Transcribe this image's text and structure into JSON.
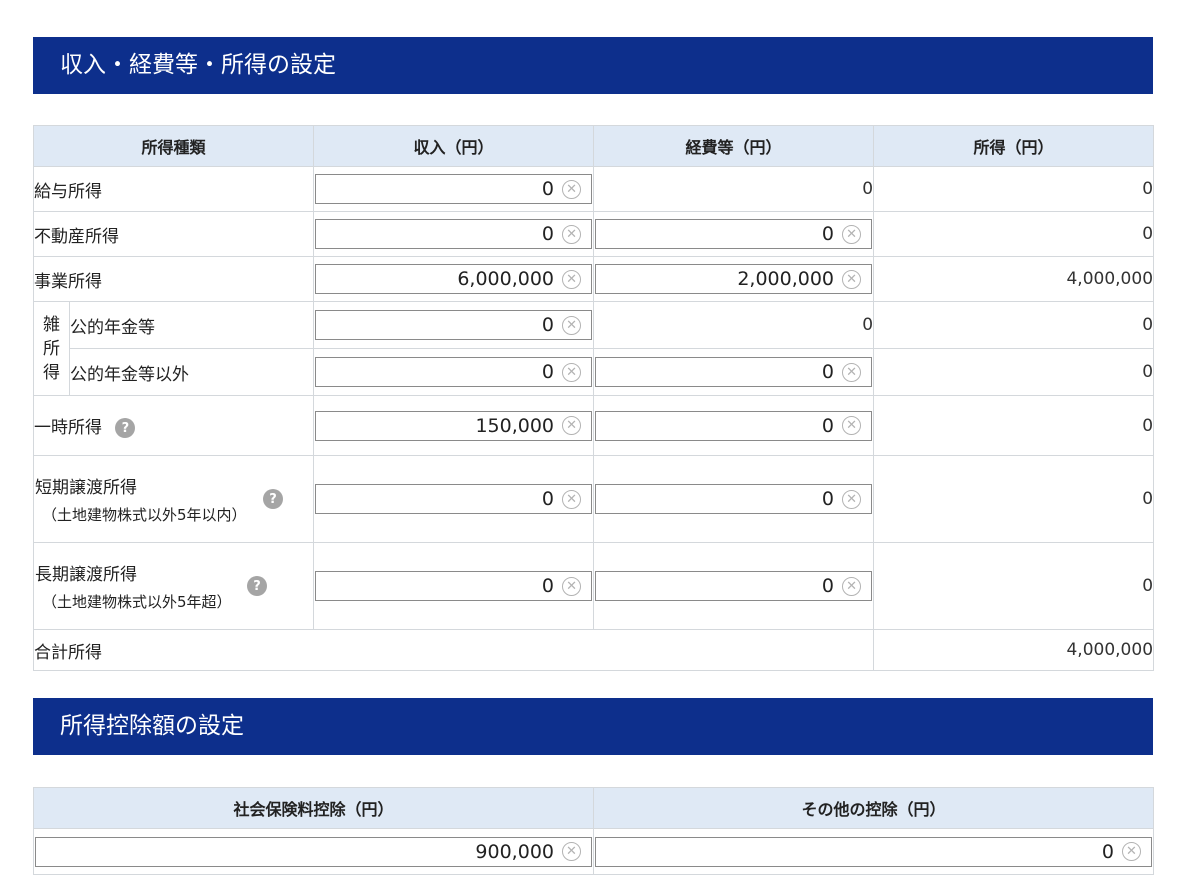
{
  "income_section": {
    "title": "収入・経費等・所得の設定",
    "headers": [
      "所得種類",
      "収入（円）",
      "経費等（円）",
      "所得（円）"
    ],
    "rows": {
      "kyuyo": {
        "label": "給与所得",
        "income": "0",
        "expense": "0",
        "result": "0"
      },
      "fudosan": {
        "label": "不動産所得",
        "income": "0",
        "expense": "0",
        "result": "0"
      },
      "jigyo": {
        "label": "事業所得",
        "income": "6,000,000",
        "expense": "2,000,000",
        "result": "4,000,000"
      },
      "zatsu_group": "雑所得",
      "nenkin": {
        "label": "公的年金等",
        "income": "0",
        "expense": "0",
        "result": "0"
      },
      "nenkin_igai": {
        "label": "公的年金等以外",
        "income": "0",
        "expense": "0",
        "result": "0"
      },
      "ichiji": {
        "label": "一時所得",
        "income": "150,000",
        "expense": "0",
        "result": "0"
      },
      "tanki": {
        "label": "短期譲渡所得",
        "sub": "（土地建物株式以外5年以内）",
        "income": "0",
        "expense": "0",
        "result": "0"
      },
      "choki": {
        "label": "長期譲渡所得",
        "sub": "（土地建物株式以外5年超）",
        "income": "0",
        "expense": "0",
        "result": "0"
      },
      "total": {
        "label": "合計所得",
        "result": "4,000,000"
      }
    }
  },
  "deduction_section": {
    "title": "所得控除額の設定",
    "headers": [
      "社会保険料控除（円）",
      "その他の控除（円）"
    ],
    "social_insurance": "900,000",
    "other": "0"
  },
  "icons": {
    "clear": "clear-circle-icon",
    "help": "help-question-icon"
  },
  "colors": {
    "header_bg": "#0d2f8c",
    "table_header_bg": "#dfe9f5"
  }
}
